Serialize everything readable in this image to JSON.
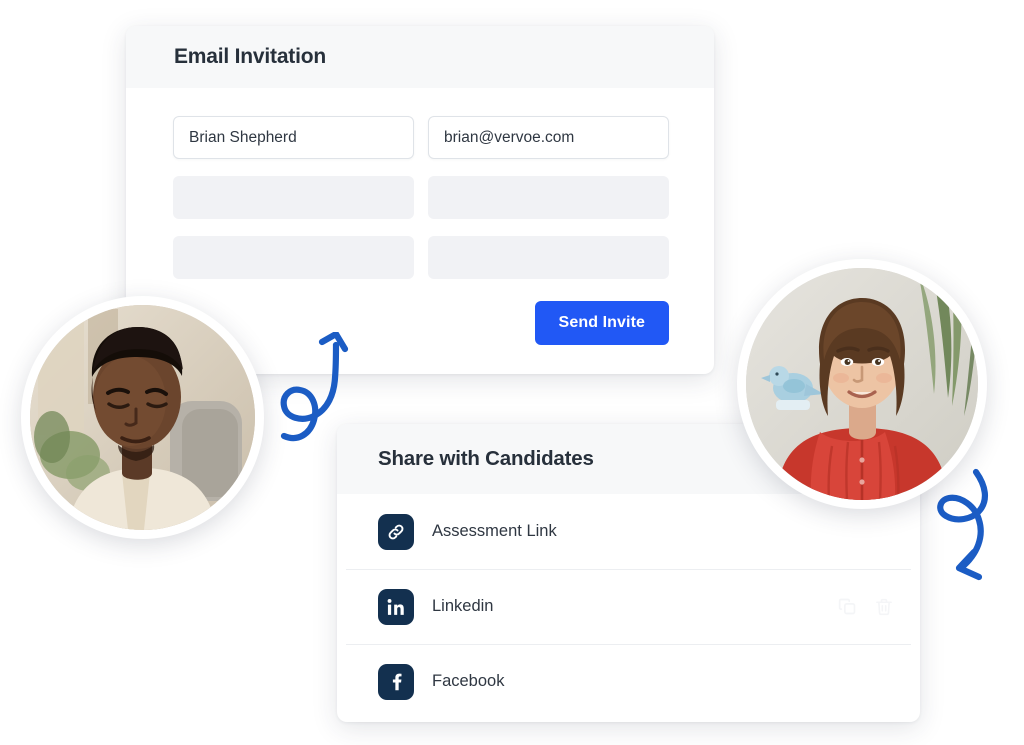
{
  "email_card": {
    "title": "Email Invitation",
    "fields": [
      {
        "name": "candidate-name",
        "value": "Brian Shepherd",
        "state": "filled"
      },
      {
        "name": "candidate-email",
        "value": "brian@vervoe.com",
        "state": "filled"
      },
      {
        "name": "candidate-name-2",
        "value": "",
        "state": "empty"
      },
      {
        "name": "candidate-email-2",
        "value": "",
        "state": "empty"
      },
      {
        "name": "candidate-name-3",
        "value": "",
        "state": "empty"
      },
      {
        "name": "candidate-email-3",
        "value": "",
        "state": "empty"
      }
    ],
    "send_button": "Send Invite",
    "accent_color": "#2158f5"
  },
  "share_card": {
    "title": "Share with Candidates",
    "icon_background": "#13304f",
    "rows": [
      {
        "label": "Assessment Link",
        "icon": "link-icon",
        "actions": []
      },
      {
        "label": "Linkedin",
        "icon": "linkedin-icon",
        "actions": [
          "copy-icon",
          "trash-icon"
        ]
      },
      {
        "label": "Facebook",
        "icon": "facebook-icon",
        "actions": []
      }
    ]
  },
  "avatars": [
    {
      "name": "candidate-avatar-left",
      "alt": "Portrait of a young man seated at a desk"
    },
    {
      "name": "candidate-avatar-right",
      "alt": "Portrait of a smiling woman in a red top"
    }
  ],
  "decorations": [
    {
      "name": "curly-arrow-up-right",
      "color": "#1b5cc4"
    },
    {
      "name": "curly-arrow-down-left",
      "color": "#1b5cc4"
    }
  ]
}
